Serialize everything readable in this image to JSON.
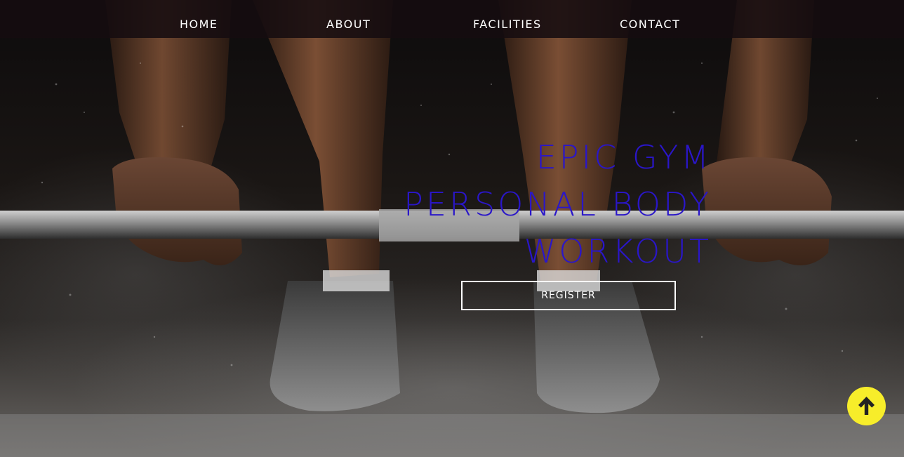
{
  "nav": {
    "items": [
      {
        "label": "HOME"
      },
      {
        "label": "ABOUT"
      },
      {
        "label": "FACILITIES"
      },
      {
        "label": "CONTACT"
      }
    ]
  },
  "hero": {
    "headline_line1": "EPIC GYM",
    "headline_line2": "PERSONAL BODY",
    "headline_line3": "WORKOUT",
    "register_label": "REGISTER",
    "headline_color": "#2a16c9"
  },
  "scroll_top": {
    "icon": "arrow-up-icon",
    "color": "#f7ed2a"
  }
}
